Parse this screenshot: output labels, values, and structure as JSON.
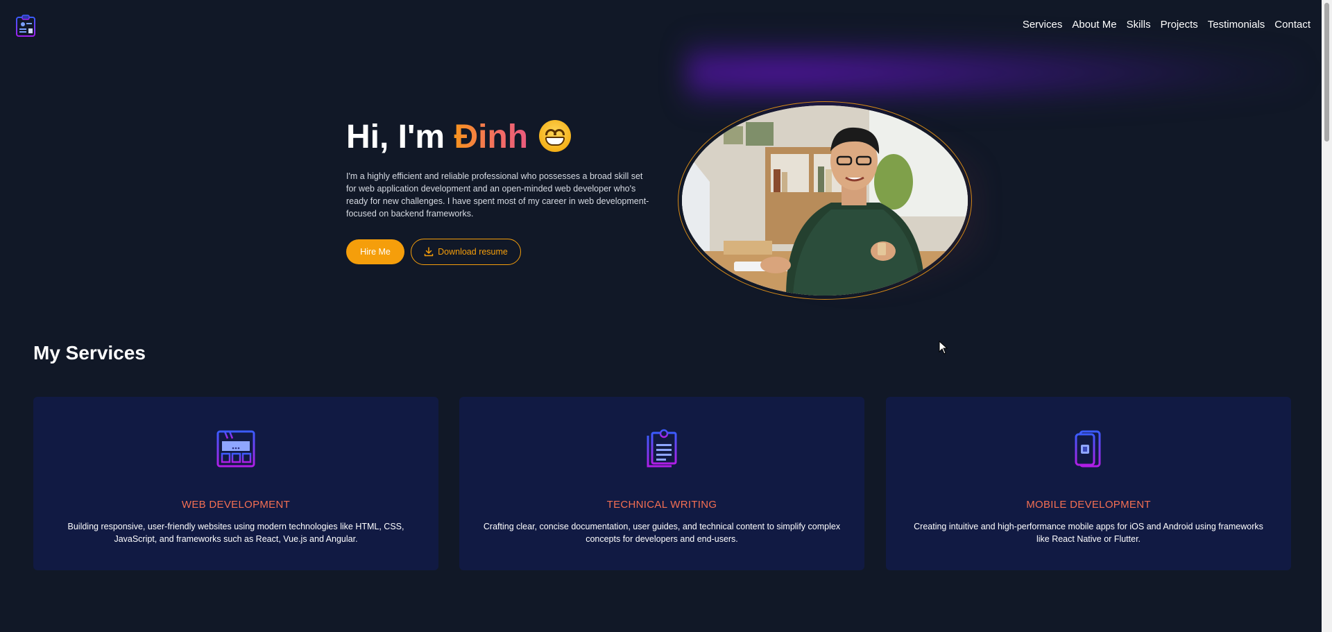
{
  "header": {
    "nav": [
      "Services",
      "About Me",
      "Skills",
      "Projects",
      "Testimonials",
      "Contact"
    ]
  },
  "hero": {
    "greeting": "Hi, I'm ",
    "name": "Đinh",
    "description": "I'm a highly efficient and reliable professional who possesses a broad skill set for web application development and an open-minded web developer who's ready for new challenges. I have spent most of my career in web development-focused on backend frameworks.",
    "hire_button": "Hire Me",
    "resume_button": "Download resume"
  },
  "services": {
    "title": "My Services",
    "cards": [
      {
        "title": "WEB DEVELOPMENT",
        "description": "Building responsive, user-friendly websites using modern technologies like HTML, CSS, JavaScript, and frameworks such as React, Vue.js and Angular."
      },
      {
        "title": "TECHNICAL WRITING",
        "description": "Crafting clear, concise documentation, user guides, and technical content to simplify complex concepts for developers and end-users."
      },
      {
        "title": "MOBILE DEVELOPMENT",
        "description": "Creating intuitive and high-performance mobile apps for iOS and Android using frameworks like React Native or Flutter."
      }
    ]
  },
  "colors": {
    "background": "#111827",
    "accent": "#f59e0b",
    "card": "#111a43",
    "service_title": "#f46f53"
  }
}
